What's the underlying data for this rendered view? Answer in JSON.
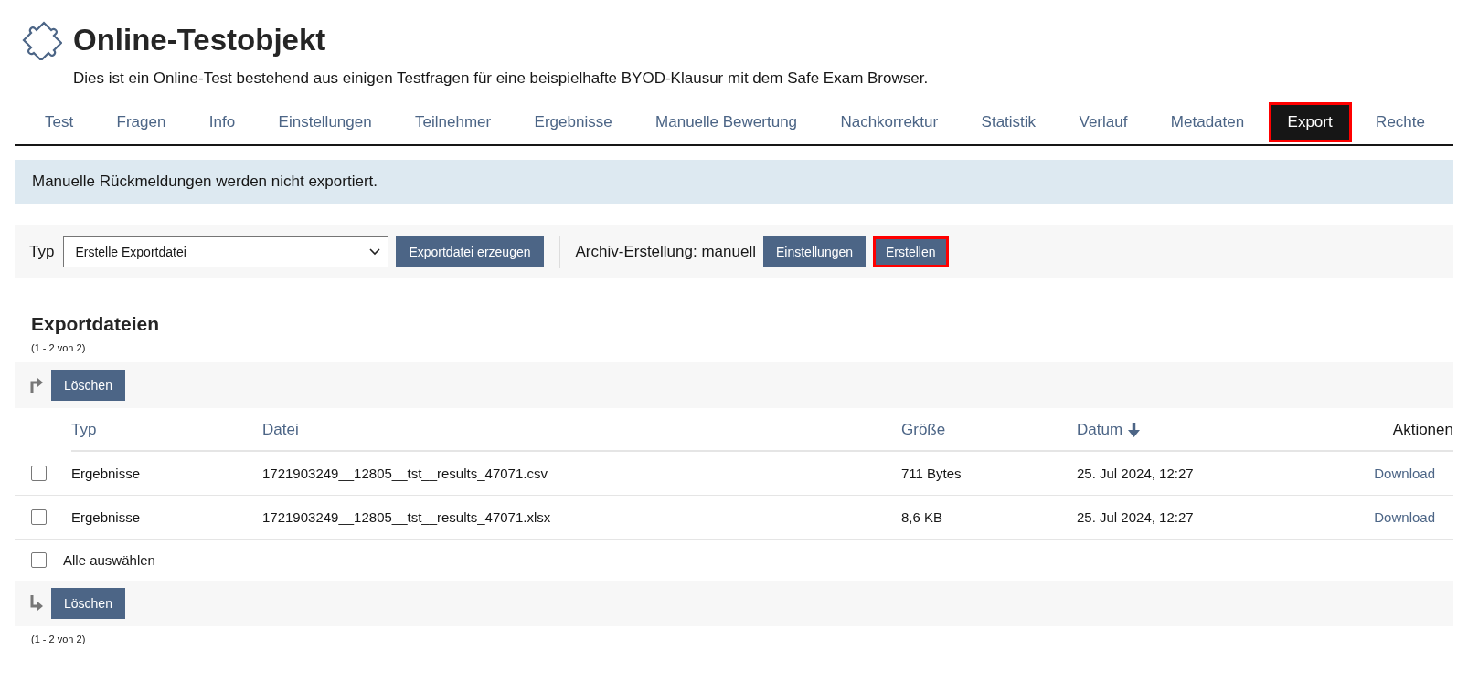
{
  "header": {
    "title": "Online-Testobjekt",
    "description": "Dies ist ein Online-Test bestehend aus einigen Testfragen für eine beispielhafte BYOD-Klausur mit dem Safe Exam Browser."
  },
  "tabs": [
    {
      "label": "Test",
      "selected": false,
      "highlighted": false
    },
    {
      "label": "Fragen",
      "selected": false,
      "highlighted": false
    },
    {
      "label": "Info",
      "selected": false,
      "highlighted": false
    },
    {
      "label": "Einstellungen",
      "selected": false,
      "highlighted": false
    },
    {
      "label": "Teilnehmer",
      "selected": false,
      "highlighted": false
    },
    {
      "label": "Ergebnisse",
      "selected": false,
      "highlighted": false
    },
    {
      "label": "Manuelle Bewertung",
      "selected": false,
      "highlighted": false
    },
    {
      "label": "Nachkorrektur",
      "selected": false,
      "highlighted": false
    },
    {
      "label": "Statistik",
      "selected": false,
      "highlighted": false
    },
    {
      "label": "Verlauf",
      "selected": false,
      "highlighted": false
    },
    {
      "label": "Metadaten",
      "selected": false,
      "highlighted": false
    },
    {
      "label": "Export",
      "selected": true,
      "highlighted": true
    },
    {
      "label": "Rechte",
      "selected": false,
      "highlighted": false
    }
  ],
  "info_message": "Manuelle Rückmeldungen werden nicht exportiert.",
  "toolbar": {
    "type_label": "Typ",
    "type_select": {
      "value": "Erstelle Exportdatei"
    },
    "create_button": {
      "label": "Exportdatei erzeugen",
      "highlighted": false
    },
    "archive_label": "Archiv-Erstellung: manuell",
    "archive_buttons": [
      {
        "label": "Einstellungen",
        "highlighted": false
      },
      {
        "label": "Erstellen",
        "highlighted": true
      }
    ]
  },
  "section": {
    "title": "Exportdateien",
    "count_top": "(1 - 2 von 2)",
    "action_top": "Löschen",
    "columns": [
      {
        "label": "Typ",
        "sortable": true,
        "sorted": false
      },
      {
        "label": "Datei",
        "sortable": true,
        "sorted": false
      },
      {
        "label": "Größe",
        "sortable": true,
        "sorted": false
      },
      {
        "label": "Datum",
        "sortable": true,
        "sorted": true
      },
      {
        "label": "Aktionen",
        "sortable": false,
        "sorted": false
      }
    ],
    "rows": [
      {
        "checked": false,
        "type": "Ergebnisse",
        "file": "1721903249__12805__tst__results_47071.csv",
        "size": "711 Bytes",
        "date": "25. Jul 2024, 12:27",
        "action": "Download"
      },
      {
        "checked": false,
        "type": "Ergebnisse",
        "file": "1721903249__12805__tst__results_47071.xlsx",
        "size": "8,6 KB",
        "date": "25. Jul 2024, 12:27",
        "action": "Download"
      }
    ],
    "select_all": {
      "label": "Alle auswählen",
      "checked": false
    },
    "action_bottom": "Löschen",
    "count_bottom": "(1 - 2 von 2)"
  }
}
